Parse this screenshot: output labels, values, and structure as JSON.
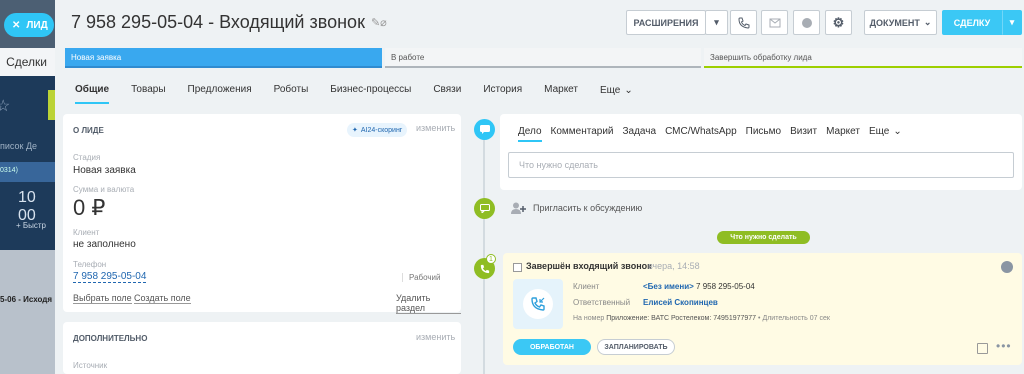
{
  "lead_tab": {
    "label": "ЛИД"
  },
  "background": {
    "tab": "Сделки",
    "search_hint": "писок   Де",
    "bar_text": "0314)",
    "number": "10 00",
    "fast": "+ Быстр",
    "deal_line": "5-06 - Исходя"
  },
  "header": {
    "title": "7 958 295-05-04 - Входящий звонок",
    "extensions": "РАСШИРЕНИЯ",
    "document": "ДОКУМЕНТ",
    "deal": "СДЕЛКУ"
  },
  "stages": [
    {
      "label": "Новая заявка"
    },
    {
      "label": "В работе"
    },
    {
      "label": "Завершить обработку лида"
    }
  ],
  "tabs": [
    {
      "label": "Общие"
    },
    {
      "label": "Товары"
    },
    {
      "label": "Предложения"
    },
    {
      "label": "Роботы"
    },
    {
      "label": "Бизнес-процессы"
    },
    {
      "label": "Связи"
    },
    {
      "label": "История"
    },
    {
      "label": "Маркет"
    },
    {
      "label": "Еще"
    }
  ],
  "about": {
    "heading": "О ЛИДЕ",
    "ai_badge": "AI24-скоринг",
    "change": "изменить",
    "stage_label": "Стадия",
    "stage_value": "Новая заявка",
    "sum_label": "Сумма и валюта",
    "sum_value": "0 ₽",
    "client_label": "Клиент",
    "client_value": "не заполнено",
    "phone_label": "Телефон",
    "phone_value": "7 958 295-05-04",
    "phone_type": "Рабочий",
    "select_field": "Выбрать поле",
    "create_field": "Создать поле",
    "delete_section": "Удалить раздел"
  },
  "extra": {
    "heading": "ДОПОЛНИТЕЛЬНО",
    "change": "изменить",
    "source_label": "Источник"
  },
  "editor": {
    "tabs": [
      {
        "label": "Дело"
      },
      {
        "label": "Комментарий"
      },
      {
        "label": "Задача"
      },
      {
        "label": "СМС/WhatsApp"
      },
      {
        "label": "Письмо"
      },
      {
        "label": "Визит"
      },
      {
        "label": "Маркет"
      },
      {
        "label": "Еще"
      }
    ],
    "placeholder": "Что нужно сделать"
  },
  "invite": {
    "label": "Пригласить к обсуждению"
  },
  "todo_label": "Что нужно сделать",
  "call": {
    "badge": "1",
    "title": "Завершён входящий звонок",
    "time": "вчера, 14:58",
    "client_label": "Клиент",
    "client_name": "<Без имени>",
    "client_phone": "7 958 295-05-04",
    "responsible_label": "Ответственный",
    "responsible_name": "Елисей Скопинцев",
    "number_label": "На номер",
    "app_text": "Приложение: ВАТС Ростелеком: 74951977977",
    "duration": "Длительность 07 сек",
    "processed": "ОБРАБОТАН",
    "plan": "ЗАПЛАНИРОВАТЬ"
  },
  "colors": {
    "accent": "#2fc6f6",
    "stage_active": "#39a8ef",
    "success": "#8fbd23",
    "call_bg": "#fffbe4",
    "link": "#2067b0"
  }
}
